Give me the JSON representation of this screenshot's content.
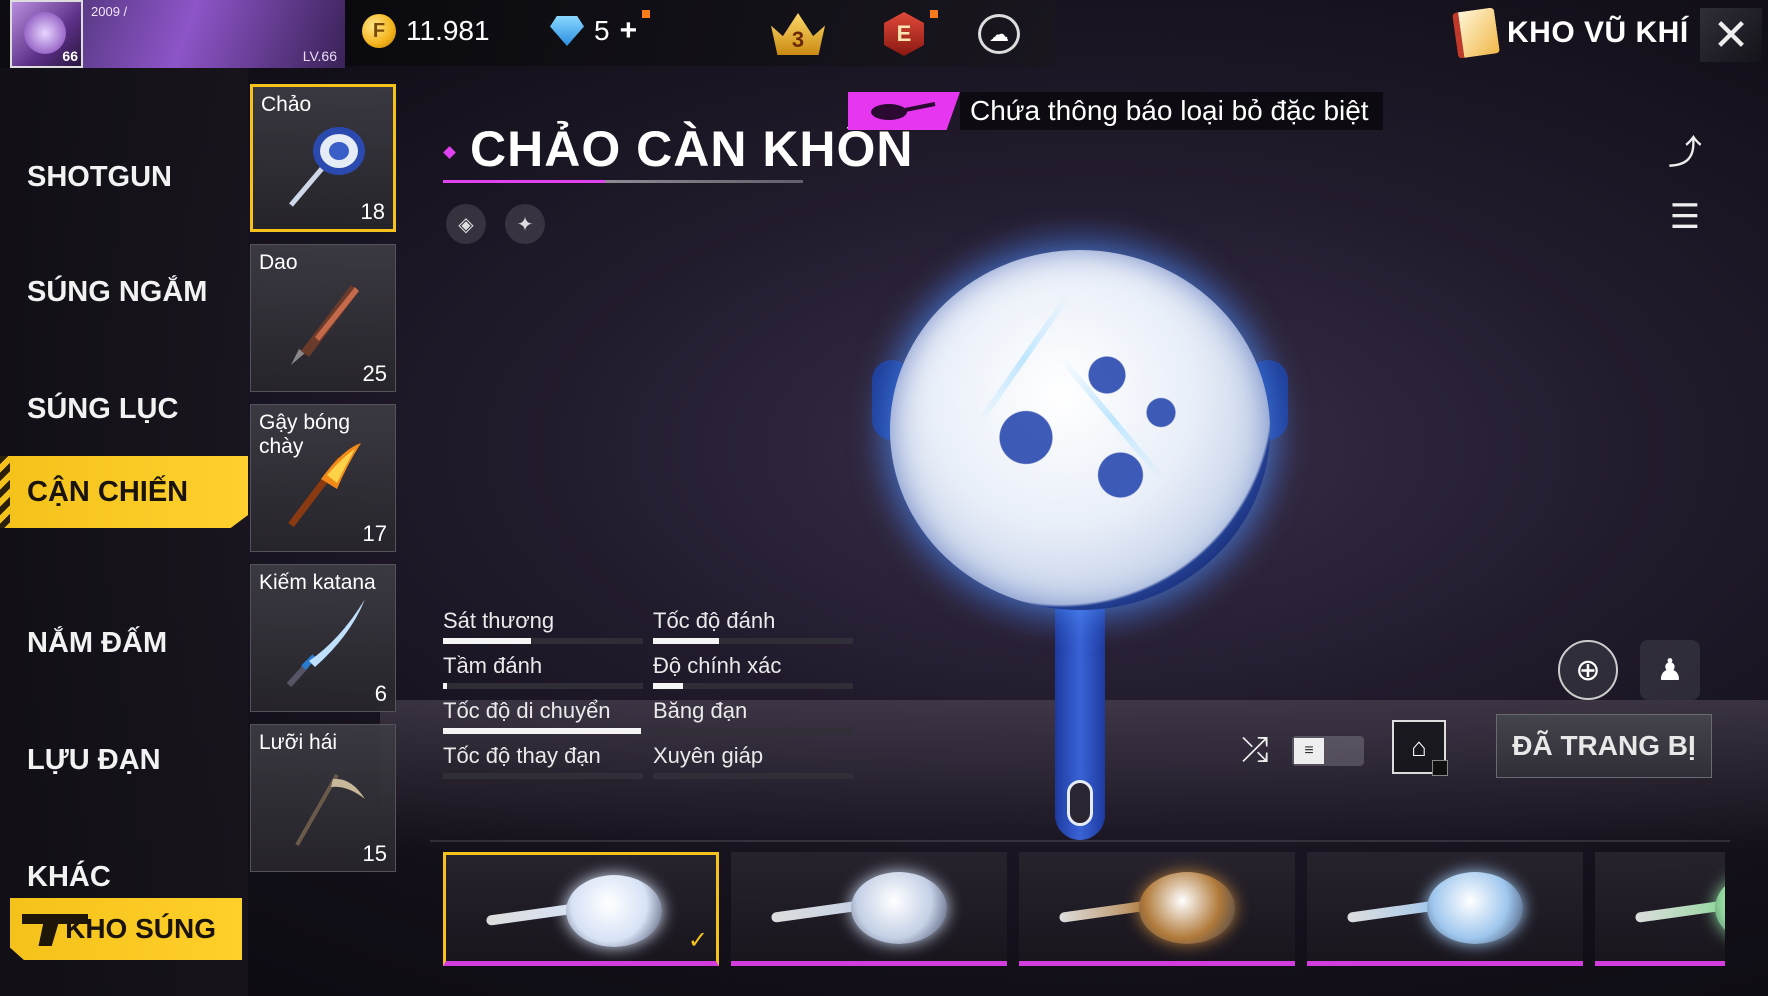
{
  "player": {
    "level_badge": "66",
    "banner_year": "2009 /",
    "banner_level": "LV.66"
  },
  "currency": {
    "gold": "11.981",
    "gold_symbol": "F",
    "diamonds": "5",
    "plus": "+"
  },
  "badges": {
    "rank": "3",
    "elite": "E"
  },
  "header": {
    "title": "KHO VŨ KHÍ",
    "close_symbol": "✕"
  },
  "sidebar": {
    "categories": [
      {
        "label": "SHOTGUN"
      },
      {
        "label": "SÚNG NGẮM"
      },
      {
        "label": "SÚNG LỤC"
      },
      {
        "label": "CẬN CHIẾN",
        "active": true
      },
      {
        "label": "NẮM ĐẤM"
      },
      {
        "label": "LỰU ĐẠN"
      },
      {
        "label": "KHÁC"
      }
    ],
    "bottom_button": "KHO SÚNG"
  },
  "weapons": [
    {
      "name": "Chảo",
      "count": "18",
      "selected": true
    },
    {
      "name": "Dao",
      "count": "25"
    },
    {
      "name": "Gậy bóng chày",
      "count": "17"
    },
    {
      "name": "Kiếm katana",
      "count": "6"
    },
    {
      "name": "Lưỡi hái",
      "count": "15"
    }
  ],
  "detail": {
    "title": "CHẢO CÀN KHÔN",
    "notice": "Chứa thông báo loại bỏ đặc biệt",
    "stats": [
      {
        "label": "Sát thương",
        "value": 0.44
      },
      {
        "label": "Tốc độ đánh",
        "value": 0.33
      },
      {
        "label": "Tầm đánh",
        "value": 0.02
      },
      {
        "label": "Độ chính xác",
        "value": 0.15
      },
      {
        "label": "Tốc độ di chuyển",
        "value": 0.99
      },
      {
        "label": "Băng đạn",
        "value": 0.0
      },
      {
        "label": "Tốc độ thay đạn",
        "value": 0.0
      },
      {
        "label": "Xuyên giáp",
        "value": 0.0
      }
    ],
    "equip_button": "ĐÃ TRANG BỊ"
  },
  "colors": {
    "accent": "#f4c21a",
    "magenta": "#e042f0",
    "skin_colors": [
      "#d7e2f6",
      "#c4d0e6",
      "#b07a3a",
      "#9fc7ee",
      "#8ed79a"
    ]
  },
  "icons": {
    "gold": "coin-icon",
    "diamond": "diamond-icon",
    "rank": "rank-badge-icon",
    "elite": "elite-pass-icon",
    "cloud": "cloud-upload-icon",
    "book": "weapon-book-icon",
    "share": "share-icon",
    "search_doc": "document-search-icon",
    "zoom": "zoom-in-icon",
    "character": "character-icon",
    "shuffle": "shuffle-icon",
    "home": "home-star-icon",
    "shuffle_glyph": "⤮",
    "list_glyph": "≡",
    "home_glyph": "⌂",
    "zoom_glyph": "⊕",
    "char_glyph": "♟",
    "share_glyph": "⤴",
    "doc_glyph": "☰",
    "cloud_glyph": "☁",
    "check_glyph": "✓",
    "attr1_glyph": "◈",
    "attr2_glyph": "✦"
  }
}
